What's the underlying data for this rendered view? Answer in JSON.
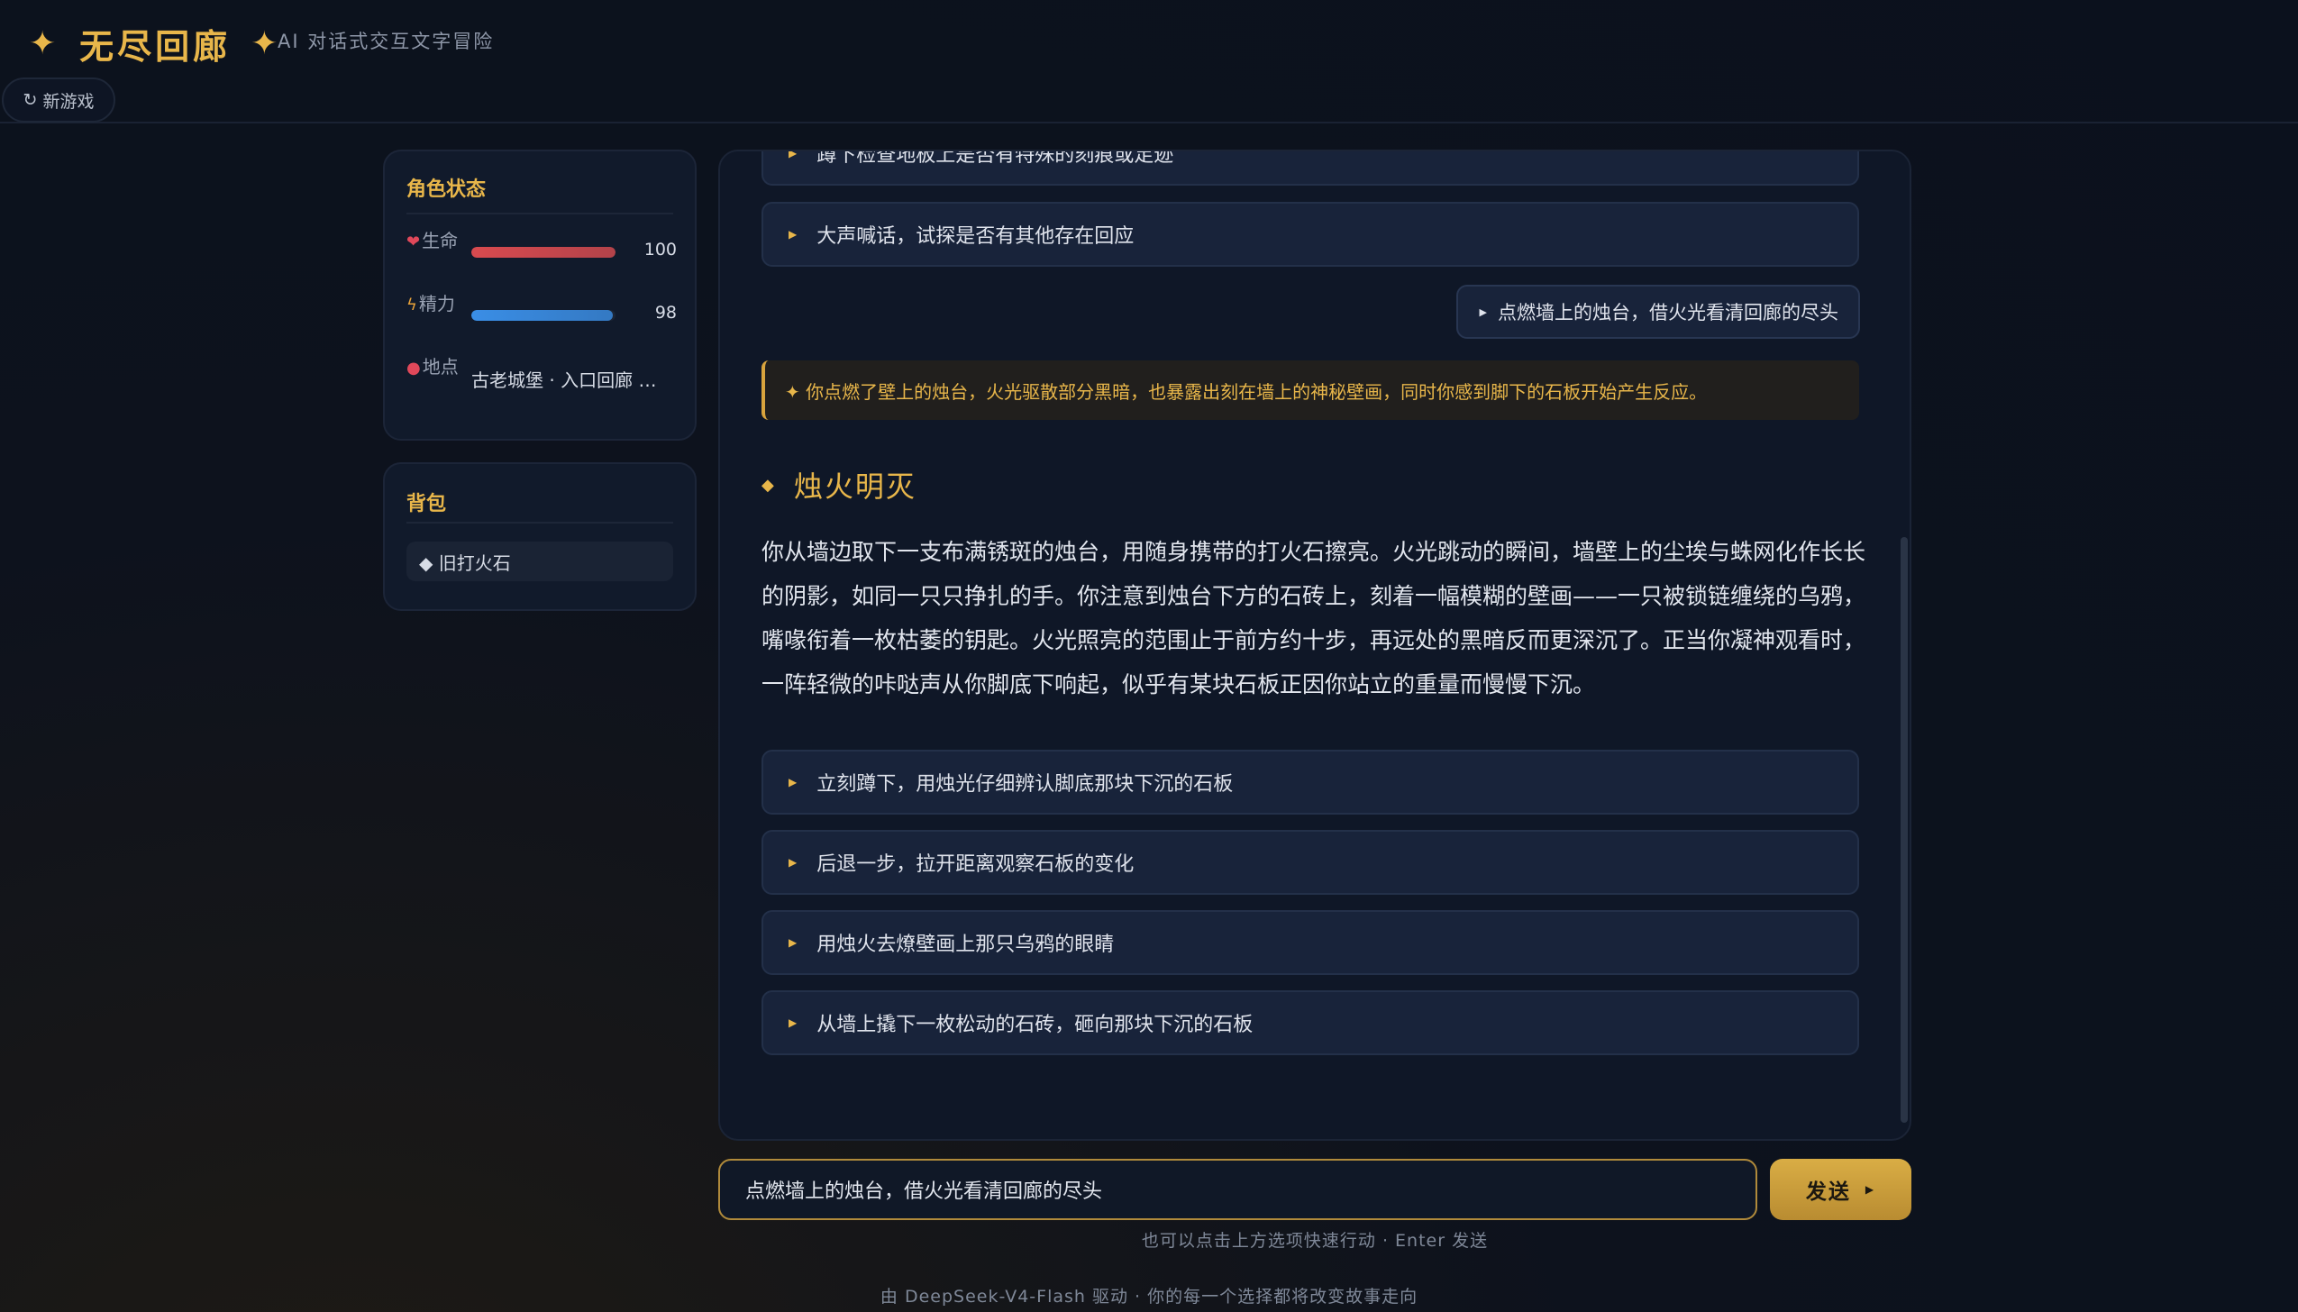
{
  "app": {
    "title": "无尽回廊",
    "subtitle": "AI 对话式交互文字冒险",
    "new_game_label": "新游戏"
  },
  "status_panel": {
    "title": "角色状态",
    "stats": [
      {
        "icon": "heart-icon",
        "label": "生命",
        "value": "100",
        "fill_percent": 100,
        "color": "#d94a4f"
      },
      {
        "icon": "lightning-icon",
        "label": "精力",
        "value": "98",
        "fill_percent": 98,
        "color": "#3a8ee6"
      },
      {
        "icon": "pin-icon",
        "label": "地点",
        "value": "古老城堡 · 入口回廊 · 石壁前"
      }
    ]
  },
  "inventory_panel": {
    "title": "背包",
    "items": [
      "◆ 旧打火石"
    ]
  },
  "chat": {
    "previous_options": [
      "蹲下检查地板上是否有特殊的刻痕或足迹",
      "大声喊话，试探是否有其他存在回应"
    ],
    "user_message": "点燃墙上的烛台，借火光看清回廊的尽头",
    "system_note": "✦ 你点燃了壁上的烛台，火光驱散部分黑暗，也暴露出刻在墙上的神秘壁画，同时你感到脚下的石板开始产生反应。",
    "scene_title": "烛火明灭",
    "narrative": "你从墙边取下一支布满锈斑的烛台，用随身携带的打火石擦亮。火光跳动的瞬间，墙壁上的尘埃与蛛网化作长长的阴影，如同一只只挣扎的手。你注意到烛台下方的石砖上，刻着一幅模糊的壁画——一只被锁链缠绕的乌鸦，嘴喙衔着一枚枯萎的钥匙。火光照亮的范围止于前方约十步，再远处的黑暗反而更深沉了。正当你凝神观看时，一阵轻微的咔哒声从你脚底下响起，似乎有某块石板正因你站立的重量而慢慢下沉。",
    "options": [
      "立刻蹲下，用烛光仔细辨认脚底那块下沉的石板",
      "后退一步，拉开距离观察石板的变化",
      "用烛火去燎壁画上那只乌鸦的眼睛",
      "从墙上撬下一枚松动的石砖，砸向那块下沉的石板"
    ]
  },
  "input": {
    "value": "点燃墙上的烛台，借火光看清回廊的尽头",
    "send_label": "发送",
    "hint": "也可以点击上方选项快速行动 · Enter 发送"
  },
  "footer": "由 DeepSeek-V4-Flash 驱动 · 你的每一个选择都将改变故事走向"
}
